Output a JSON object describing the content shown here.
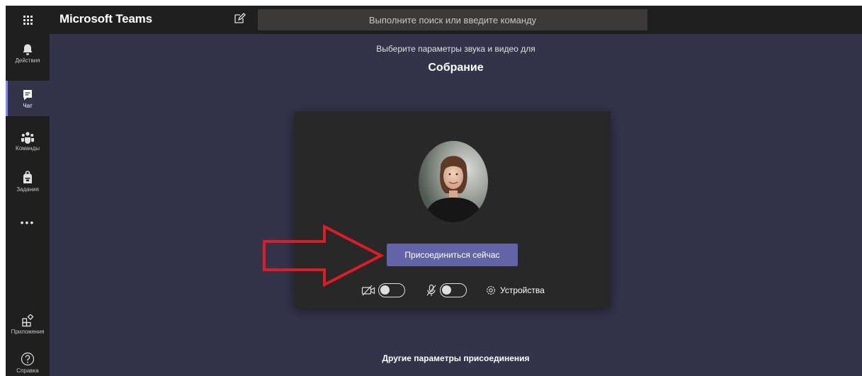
{
  "app": {
    "title": "Microsoft Teams"
  },
  "search": {
    "placeholder": "Выполните поиск или введите команду"
  },
  "rail": {
    "items": [
      {
        "label": "Действия",
        "icon": "bell-icon"
      },
      {
        "label": "Чат",
        "icon": "chat-icon",
        "active": true
      },
      {
        "label": "Команды",
        "icon": "teams-icon"
      },
      {
        "label": "Задания",
        "icon": "assignments-icon"
      },
      {
        "label": "Приложения",
        "icon": "apps-icon"
      },
      {
        "label": "Справка",
        "icon": "help-icon"
      }
    ],
    "more": "•••"
  },
  "prejoin": {
    "subtitle": "Выберите параметры звука и видео для",
    "meeting_title": "Собрание",
    "join_label": "Присоединиться сейчас",
    "camera": {
      "on": false,
      "icon": "camera-off-icon"
    },
    "microphone": {
      "on": false,
      "icon": "mic-off-icon"
    },
    "devices_label": "Устройства",
    "other_options": "Другие параметры присоединения"
  },
  "colors": {
    "accent": "#6264a7",
    "background": "#33344a",
    "rail": "#201f1f",
    "panel": "#292828",
    "annotation": "#e01b24"
  }
}
